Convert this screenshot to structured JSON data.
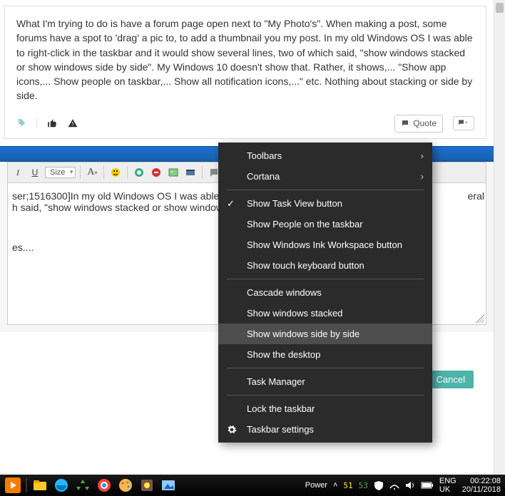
{
  "post": {
    "body": "What I'm trying to do is have a forum page open next to \"My Photo's\". When making a post, some forums have a spot to 'drag' a pic to, to add a thumbnail you my post. In my old Windows OS I was able to right-click in the taskbar and it would show several lines, two of which said, \"show windows stacked or show windows side by side\". My Windows 10 doesn't show that. Rather, it shows,... \"Show app icons,... Show people on taskbar,... Show all notification icons,...\" etc. Nothing about stacking or side by side.",
    "quote_label": "Quote"
  },
  "editor": {
    "size_label": "Size",
    "line1": "ser;1516300]In my old Windows OS I was able t",
    "line1_tail": "eral",
    "line2": "h said, \"show windows stacked or show window",
    "line3": "es....",
    "cancel_label": "Cancel"
  },
  "context_menu": {
    "items": [
      {
        "label": "Toolbars",
        "submenu": true
      },
      {
        "label": "Cortana",
        "submenu": true
      },
      {
        "sep": true
      },
      {
        "label": "Show Task View button",
        "checked": true
      },
      {
        "label": "Show People on the taskbar"
      },
      {
        "label": "Show Windows Ink Workspace button"
      },
      {
        "label": "Show touch keyboard button"
      },
      {
        "sep": true
      },
      {
        "label": "Cascade windows"
      },
      {
        "label": "Show windows stacked"
      },
      {
        "label": "Show windows side by side",
        "hover": true
      },
      {
        "label": "Show the desktop"
      },
      {
        "sep": true
      },
      {
        "label": "Task Manager"
      },
      {
        "sep": true
      },
      {
        "label": "Lock the taskbar"
      },
      {
        "label": "Taskbar settings",
        "gear": true
      }
    ]
  },
  "tray": {
    "power_label": "Power",
    "temp1": "51",
    "temp2": "53",
    "lang1": "ENG",
    "lang2": "UK",
    "time": "00:22:08",
    "date": "20/11/2018"
  }
}
